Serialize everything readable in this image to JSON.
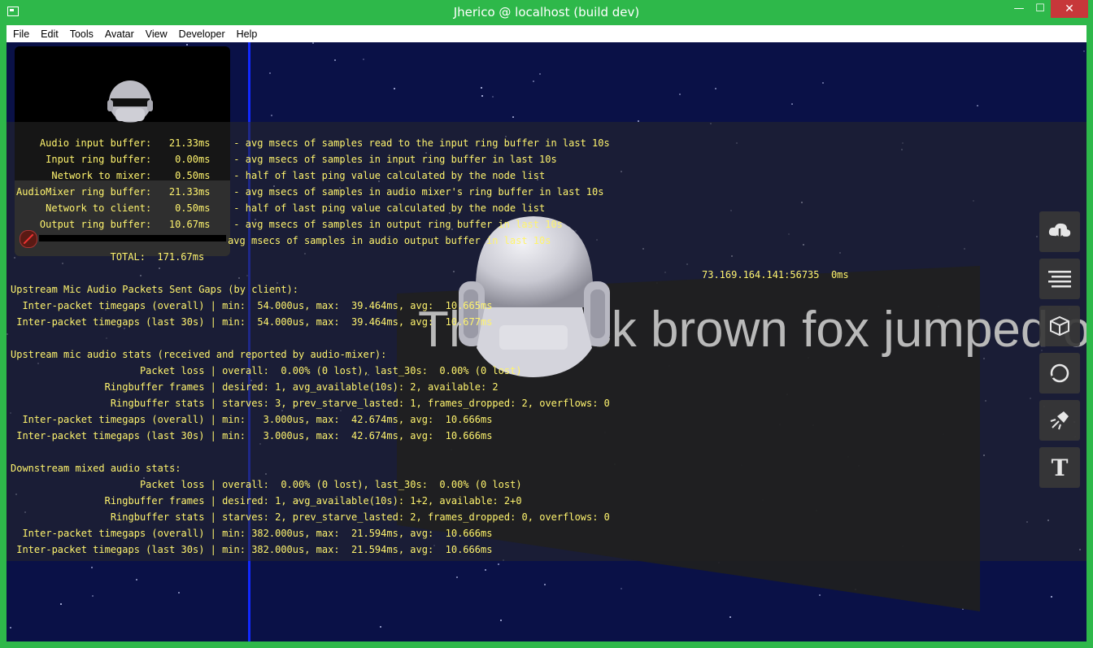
{
  "window": {
    "title": "Jherico @ localhost (build dev)",
    "controls": {
      "minimize": "—",
      "maximize": "☐",
      "close": "✕"
    }
  },
  "menu": [
    "File",
    "Edit",
    "Tools",
    "Avatar",
    "View",
    "Developer",
    "Help"
  ],
  "audio_buffers": [
    {
      "text": "    Audio input buffer:   21.33ms    - avg msecs of samples read to the input ring buffer in last 10s"
    },
    {
      "text": "     Input ring buffer:    0.00ms    - avg msecs of samples in input ring buffer in last 10s"
    },
    {
      "text": "      Network to mixer:    0.50ms    - half of last ping value calculated by the node list"
    },
    {
      "text": "AudioMixer ring buffer:   21.33ms    - avg msecs of samples in audio mixer's ring buffer in last 10s"
    },
    {
      "text": "     Network to client:    0.50ms    - half of last ping value calculated by the node list"
    },
    {
      "text": "    Output ring buffer:   10.67ms    - avg msecs of samples in output ring buffer in last 10s"
    },
    {
      "text": "                                    avg msecs of samples in audio output buffer in last 10s"
    },
    {
      "text": "                TOTAL:  171.67ms"
    }
  ],
  "upstream_gaps": {
    "title": "Upstream Mic Audio Packets Sent Gaps (by client):",
    "lines": [
      "  Inter-packet timegaps (overall) | min:  54.000us, max:  39.464ms, avg:  10.665ms",
      " Inter-packet timegaps (last 30s) | min:  54.000us, max:  39.464ms, avg:  10.677ms"
    ]
  },
  "upstream_stats": {
    "title": "Upstream mic audio stats (received and reported by audio-mixer):",
    "lines": [
      "                      Packet loss | overall:  0.00% (0 lost), last_30s:  0.00% (0 lost)",
      "                Ringbuffer frames | desired: 1, avg_available(10s): 2, available: 2",
      "                 Ringbuffer stats | starves: 3, prev_starve_lasted: 1, frames_dropped: 2, overflows: 0",
      "  Inter-packet timegaps (overall) | min:   3.000us, max:  42.674ms, avg:  10.666ms",
      " Inter-packet timegaps (last 30s) | min:   3.000us, max:  42.674ms, avg:  10.666ms"
    ]
  },
  "downstream_stats": {
    "title": "Downstream mixed audio stats:",
    "lines": [
      "                      Packet loss | overall:  0.00% (0 lost), last_30s:  0.00% (0 lost)",
      "                Ringbuffer frames | desired: 1, avg_available(10s): 1+2, available: 2+0",
      "                 Ringbuffer stats | starves: 2, prev_starve_lasted: 2, frames_dropped: 0, overflows: 0",
      "  Inter-packet timegaps (overall) | min: 382.000us, max:  21.594ms, avg:  10.666ms",
      " Inter-packet timegaps (last 30s) | min: 382.000us, max:  21.594ms, avg:  10.666ms"
    ]
  },
  "node_address": "73.169.164.141:56735  0ms",
  "text_entity": "The quick brown fox jumped o",
  "toolbar": [
    {
      "icon": "marketplace-icon"
    },
    {
      "icon": "directory-icon"
    },
    {
      "icon": "cube-icon"
    },
    {
      "icon": "sphere-icon"
    },
    {
      "icon": "light-icon"
    },
    {
      "icon": "text-icon",
      "label": "T"
    }
  ],
  "colors": {
    "stats_text": "#fff46e",
    "titlebar": "#2eb84a",
    "scene_bg": "#0a1147",
    "close": "#c7373a"
  }
}
